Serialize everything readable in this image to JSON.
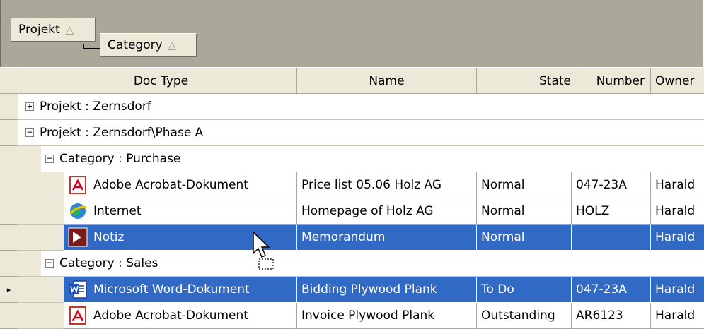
{
  "group_panel": {
    "chips": [
      {
        "label": "Projekt",
        "sort_icon": "sort-ascending-triangle-icon"
      },
      {
        "label": "Category",
        "sort_icon": "sort-ascending-triangle-icon"
      }
    ]
  },
  "columns": [
    "Doc Type",
    "Name",
    "State",
    "Number",
    "Owner"
  ],
  "groups": [
    {
      "label": "Projekt : Zernsdorf",
      "expanded": false
    },
    {
      "label": "Projekt : Zernsdorf\\Phase A",
      "expanded": true
    }
  ],
  "subgroups": [
    {
      "label": "Category : Purchase",
      "expanded": true
    },
    {
      "label": "Category : Sales",
      "expanded": true
    }
  ],
  "rows": [
    {
      "doc_type": "Adobe Acrobat-Dokument",
      "name": "Price list 05.06 Holz AG",
      "state": "Normal",
      "number": "047-23A",
      "owner": "Harald",
      "icon": "pdf-icon",
      "selected": false
    },
    {
      "doc_type": "Internet",
      "name": "Homepage of Holz AG",
      "state": "Normal",
      "number": "HOLZ",
      "owner": "Harald",
      "icon": "internet-globe-icon",
      "selected": false
    },
    {
      "doc_type": "Notiz",
      "name": "Memorandum",
      "state": "Normal",
      "number": "",
      "owner": "Harald",
      "icon": "note-icon",
      "selected": true
    },
    {
      "doc_type": "Microsoft Word-Dokument",
      "name": "Bidding Plywood Plank",
      "state": "To Do",
      "number": "047-23A",
      "owner": "Harald",
      "icon": "word-document-icon",
      "selected": true
    },
    {
      "doc_type": "Adobe Acrobat-Dokument",
      "name": "Invoice Plywood Plank",
      "state": "Outstanding",
      "number": "AR6123",
      "owner": "Harald",
      "icon": "pdf-icon",
      "selected": false
    }
  ],
  "icons": {
    "expanded_glyph": "−",
    "collapsed_glyph": "+",
    "row_indicator_glyph": "▸",
    "sort_glyph": "△"
  },
  "colors": {
    "selection": "#316ac5",
    "panel": "#aca899",
    "header": "#ece9d8"
  }
}
